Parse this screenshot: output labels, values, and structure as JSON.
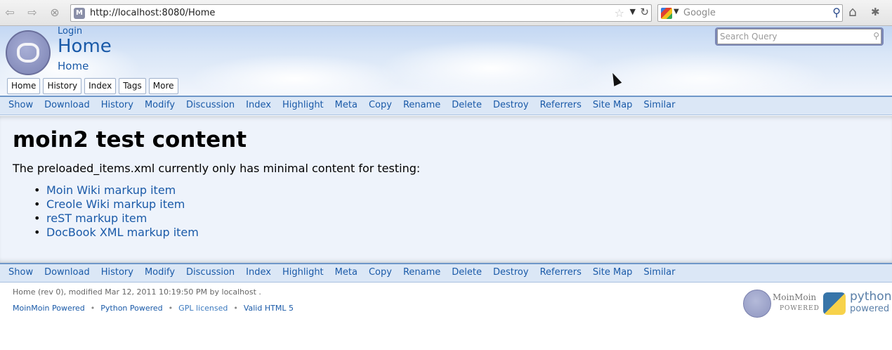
{
  "browser": {
    "url": "http://localhost:8080/Home",
    "search_engine_placeholder": "Google"
  },
  "header": {
    "login_label": "Login",
    "title": "Home",
    "breadcrumb": "Home",
    "tabs": [
      {
        "label": "Home"
      },
      {
        "label": "History"
      },
      {
        "label": "Index"
      },
      {
        "label": "Tags"
      },
      {
        "label": "More"
      }
    ],
    "search_placeholder": "Search Query"
  },
  "actions": [
    {
      "label": "Show"
    },
    {
      "label": "Download"
    },
    {
      "label": "History"
    },
    {
      "label": "Modify"
    },
    {
      "label": "Discussion"
    },
    {
      "label": "Index"
    },
    {
      "label": "Highlight"
    },
    {
      "label": "Meta"
    },
    {
      "label": "Copy"
    },
    {
      "label": "Rename"
    },
    {
      "label": "Delete"
    },
    {
      "label": "Destroy"
    },
    {
      "label": "Referrers"
    },
    {
      "label": "Site Map"
    },
    {
      "label": "Similar"
    }
  ],
  "content": {
    "title": "moin2 test content",
    "intro": "The preloaded_items.xml currently only has minimal content for testing:",
    "items": [
      {
        "label": "Moin Wiki markup item"
      },
      {
        "label": "Creole Wiki markup item"
      },
      {
        "label": "reST markup item"
      },
      {
        "label": "DocBook XML markup item"
      }
    ]
  },
  "footer": {
    "info": "Home (rev 0), modified Mar 12, 2011 10:19:50 PM by localhost .",
    "links": [
      {
        "label": "MoinMoin Powered",
        "color": "#1a5aa8"
      },
      {
        "label": "Python Powered",
        "color": "#1a5aa8"
      },
      {
        "label": "GPL licensed",
        "color": "#3c7abf"
      },
      {
        "label": "Valid HTML 5",
        "color": "#1a5aa8"
      }
    ],
    "separator": "•",
    "moin_badge_text": "MoinMoin",
    "moin_badge_sub": "POWERED",
    "python_badge_text": "python",
    "python_badge_sub": "powered"
  },
  "colors": {
    "link": "#1a5aa8",
    "actionbar_bg": "#dbe7f6",
    "content_bg": "#eef3fb"
  }
}
